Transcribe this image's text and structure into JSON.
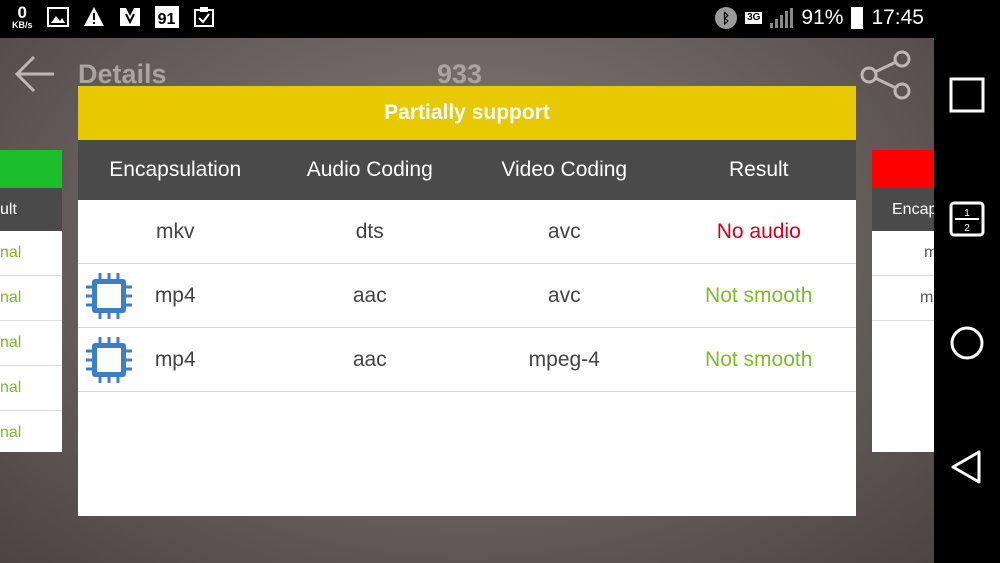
{
  "status_bar": {
    "speed_value": "0",
    "speed_unit": "KB/s",
    "calendar_day": "91",
    "network_type": "3G",
    "battery_percent": "91%",
    "time": "17:45"
  },
  "app_bar": {
    "title": "Details",
    "count": "933"
  },
  "left_panel": {
    "header": "ult",
    "cells": [
      "nal",
      "nal",
      "nal",
      "nal",
      "nal"
    ],
    "accent_color": "#1bbf2b"
  },
  "right_panel": {
    "header": "Encap",
    "cells": [
      "m",
      "m"
    ],
    "accent_color": "#ff0000"
  },
  "dialog": {
    "title": "Partially support",
    "title_color": "#e8c800",
    "columns": [
      "Encapsulation",
      "Audio Coding",
      "Video Coding",
      "Result"
    ],
    "rows": [
      {
        "icon": "",
        "encapsulation": "mkv",
        "audio": "dts",
        "video": "avc",
        "result": "No audio"
      },
      {
        "icon": "chip-icon",
        "encapsulation": "mp4",
        "audio": "aac",
        "video": "avc",
        "result": "Not smooth"
      },
      {
        "icon": "chip-icon",
        "encapsulation": "mp4",
        "audio": "aac",
        "video": "mpeg-4",
        "result": "Not smooth"
      }
    ]
  },
  "nav_bar": {
    "buttons": [
      "recents-square-icon",
      "split-screen-icon",
      "home-circle-icon",
      "back-triangle-icon"
    ],
    "split_labels": [
      "1",
      "2"
    ]
  }
}
